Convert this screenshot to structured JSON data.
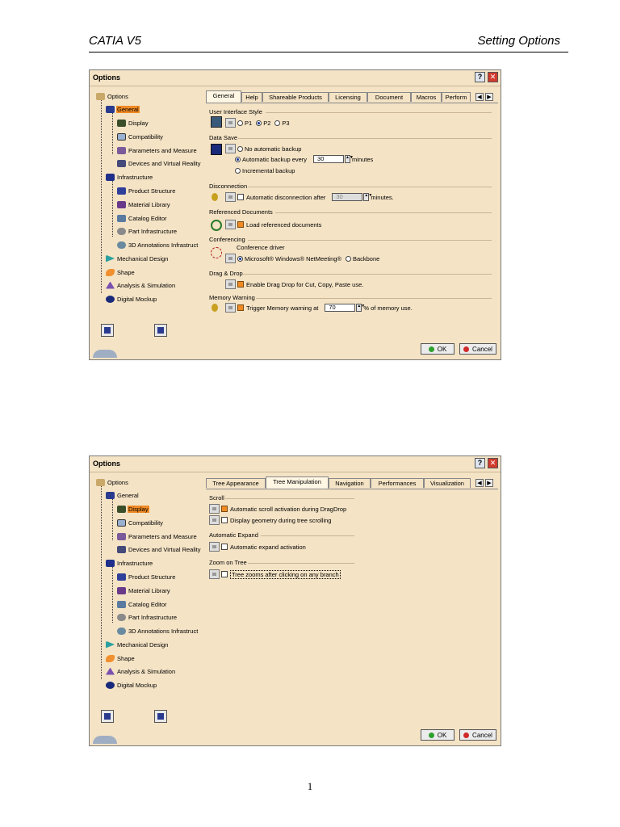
{
  "header": {
    "left": "CATIA V5",
    "right": "Setting Options"
  },
  "page_number": "1",
  "tree_labels": {
    "options": "Options",
    "general": "General",
    "display": "Display",
    "compatibility": "Compatibility",
    "parameters": "Parameters and Measure",
    "devices": "Devices and Virtual Reality",
    "infrastructure": "Infrastructure",
    "product_structure": "Product Structure",
    "material_library": "Material Library",
    "catalog_editor": "Catalog Editor",
    "part_infrastructure": "Part Infrastructure",
    "annotations_3d": "3D Annotations Infrastruct",
    "mechanical_design": "Mechanical Design",
    "shape": "Shape",
    "analysis1": "Analysis & Simulation",
    "analysis2": "Analysis & Simulation",
    "digital_mockup": "Digital Mockup"
  },
  "dialog1": {
    "title": "Options",
    "tabs": [
      "General",
      "Help",
      "Shareable Products",
      "Licensing",
      "Document",
      "Macros",
      "Perform"
    ],
    "ui_style": {
      "title": "User Interface Style",
      "options": [
        "P1",
        "P2",
        "P3"
      ],
      "selected": "P2"
    },
    "data_save": {
      "title": "Data Save",
      "no_backup": "No automatic backup",
      "auto_backup": "Automatic backup every",
      "backup_value": "30",
      "minutes": "minutes",
      "incremental": "Incremental backup"
    },
    "disconnection": {
      "title": "Disconnection",
      "label": "Automatic disconnection after",
      "value": "30",
      "unit": "minutes."
    },
    "referenced": {
      "title": "Referenced Documents",
      "label": "Load referenced documents"
    },
    "conferencing": {
      "title": "Conferencing",
      "driver": "Conference driver",
      "opt1": "Microsoft® Windows® NetMeeting®",
      "opt2": "Backbone"
    },
    "drag_drop": {
      "title": "Drag & Drop",
      "label": "Enable Drag Drop for Cut, Copy, Paste use."
    },
    "memory": {
      "title": "Memory Warning",
      "label": "Trigger Memory warning at",
      "value": "70",
      "unit": "% of memory use."
    },
    "ok": "OK",
    "cancel": "Cancel"
  },
  "dialog2": {
    "title": "Options",
    "tabs": [
      "Tree Appearance",
      "Tree Manipulation",
      "Navigation",
      "Performances",
      "Visualization"
    ],
    "scroll": {
      "title": "Scroll",
      "opt1": "Automatic scroll activation during DragDrop",
      "opt2": "Display geometry during tree scrolling"
    },
    "expand": {
      "title": "Automatic Expand",
      "opt1": "Automatic expand activation"
    },
    "zoom": {
      "title": "Zoom on Tree",
      "opt1": "Tree zooms after clicking on any branch"
    },
    "ok": "OK",
    "cancel": "Cancel"
  }
}
